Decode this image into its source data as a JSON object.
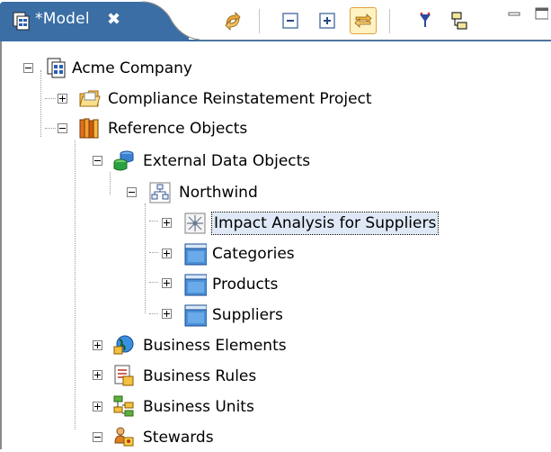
{
  "view": {
    "tab_title": "*Model",
    "tab_close": "✖",
    "tab_icon": "model-icon"
  },
  "toolbar": {
    "items": [
      "sync-icon",
      "collapse-all-icon",
      "expand-all-icon",
      "link-with-editor-icon",
      "filter-icon",
      "hierarchy-icon"
    ],
    "active": "link-with-editor-icon"
  },
  "tree": {
    "root": "Acme Company",
    "compliance": "Compliance Reinstatement Project",
    "reference_objects": "Reference Objects",
    "external_data_objects": "External Data Objects",
    "northwind": "Northwind",
    "impact_analysis": "Impact Analysis for Suppliers",
    "categories": "Categories",
    "products": "Products",
    "suppliers": "Suppliers",
    "business_elements": "Business Elements",
    "business_rules": "Business Rules",
    "business_units": "Business Units",
    "stewards": "Stewards"
  },
  "colors": {
    "tab_active": "#3a6ea5",
    "selection": "#dfe8f6",
    "toolbar_active_bg": "#fff3c4"
  }
}
